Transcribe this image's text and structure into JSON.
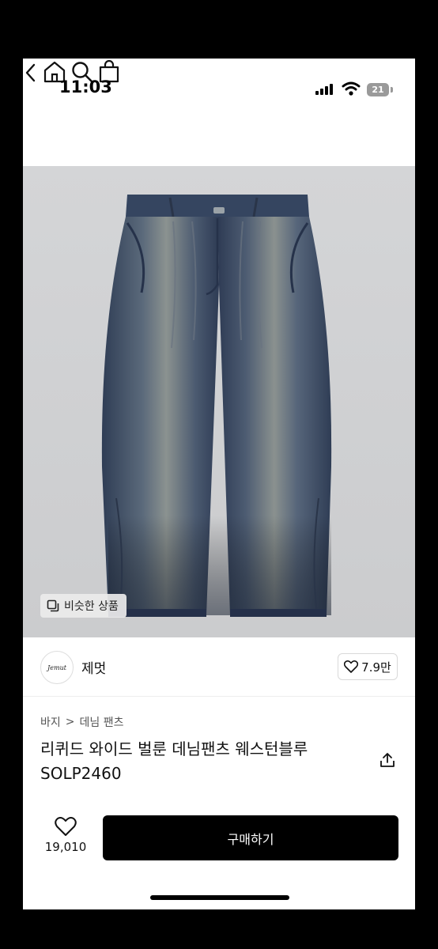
{
  "status_bar": {
    "time": "11:03",
    "battery": "21"
  },
  "product": {
    "similar_label": "비슷한 상품",
    "breadcrumb": [
      "바지",
      "데님 팬츠"
    ],
    "breadcrumb_sep": ">",
    "title": "리퀴드 와이드 벌룬 데님팬츠 웨스턴블루 SOLP2460",
    "image_alt": "denim wide balloon pants"
  },
  "seller": {
    "logo_text": "Jemut",
    "name": "제멋",
    "likes": "7.9만"
  },
  "buy_bar": {
    "wish_count": "19,010",
    "buy_label": "구매하기"
  },
  "icons": [
    "back-icon",
    "home-icon",
    "search-icon",
    "bag-icon",
    "share-icon",
    "heart-icon",
    "similar-icon"
  ],
  "colors": {
    "accent": "#000000",
    "denim": "#3d4e6a"
  }
}
